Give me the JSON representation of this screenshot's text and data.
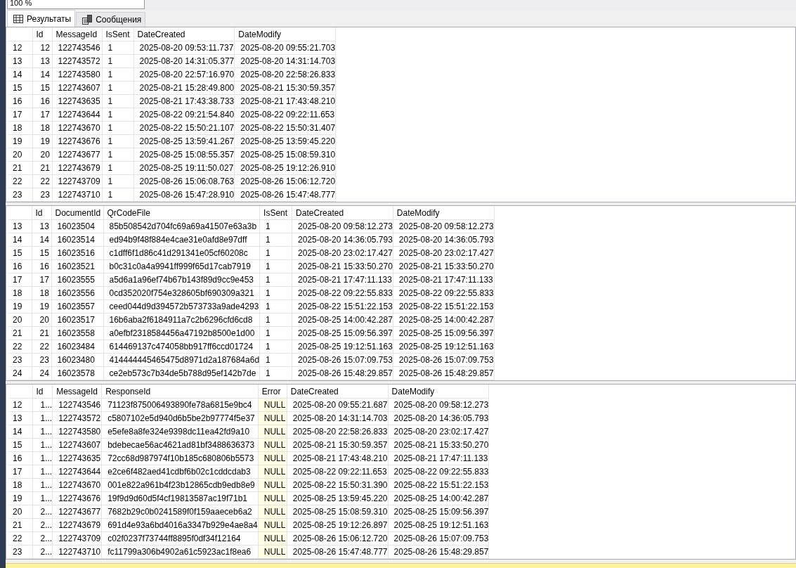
{
  "zoom": {
    "value": "100 %"
  },
  "tabs": [
    {
      "label": "Результаты",
      "kind": "grid",
      "selected": true
    },
    {
      "label": "Сообщения",
      "kind": "messages",
      "selected": false
    }
  ],
  "grids": [
    {
      "columns": [
        {
          "name": "Id",
          "kind": "text"
        },
        {
          "name": "MessageId",
          "kind": "text"
        },
        {
          "name": "IsSent",
          "kind": "text"
        },
        {
          "name": "DateCreated",
          "kind": "text"
        },
        {
          "name": "DateModify",
          "kind": "text"
        }
      ],
      "rows": [
        {
          "number": "12",
          "cells": [
            "12",
            "122743546",
            "1",
            "2025-08-20 09:53:11.737",
            "2025-08-20 09:55:21.703"
          ]
        },
        {
          "number": "13",
          "cells": [
            "13",
            "122743572",
            "1",
            "2025-08-20 14:31:05.377",
            "2025-08-20 14:31:14.703"
          ]
        },
        {
          "number": "14",
          "cells": [
            "14",
            "122743580",
            "1",
            "2025-08-20 22:57:16.970",
            "2025-08-20 22:58:26.833"
          ]
        },
        {
          "number": "15",
          "cells": [
            "15",
            "122743607",
            "1",
            "2025-08-21 15:28:49.800",
            "2025-08-21 15:30:59.357"
          ]
        },
        {
          "number": "16",
          "cells": [
            "16",
            "122743635",
            "1",
            "2025-08-21 17:43:38.733",
            "2025-08-21 17:43:48.210"
          ]
        },
        {
          "number": "17",
          "cells": [
            "17",
            "122743644",
            "1",
            "2025-08-22 09:21:54.840",
            "2025-08-22 09:22:11.653"
          ]
        },
        {
          "number": "18",
          "cells": [
            "18",
            "122743670",
            "1",
            "2025-08-22 15:50:21.107",
            "2025-08-22 15:50:31.407"
          ]
        },
        {
          "number": "19",
          "cells": [
            "19",
            "122743676",
            "1",
            "2025-08-25 13:59:41.267",
            "2025-08-25 13:59:45.220"
          ]
        },
        {
          "number": "20",
          "cells": [
            "20",
            "122743677",
            "1",
            "2025-08-25 15:08:55.357",
            "2025-08-25 15:08:59.310"
          ]
        },
        {
          "number": "21",
          "cells": [
            "21",
            "122743679",
            "1",
            "2025-08-25 19:11:50.027",
            "2025-08-25 19:12:26.910"
          ]
        },
        {
          "number": "22",
          "cells": [
            "22",
            "122743709",
            "1",
            "2025-08-26 15:06:08.763",
            "2025-08-26 15:06:12.720"
          ]
        },
        {
          "number": "23",
          "cells": [
            "23",
            "122743710",
            "1",
            "2025-08-26 15:47:28.910",
            "2025-08-26 15:47:48.777"
          ]
        }
      ]
    },
    {
      "columns": [
        {
          "name": "Id",
          "kind": "text"
        },
        {
          "name": "DocumentId",
          "kind": "text"
        },
        {
          "name": "QrCodeFile",
          "kind": "text"
        },
        {
          "name": "IsSent",
          "kind": "text"
        },
        {
          "name": "DateCreated",
          "kind": "text"
        },
        {
          "name": "DateModify",
          "kind": "text"
        }
      ],
      "rows": [
        {
          "number": "13",
          "cells": [
            "13",
            "16023504",
            "85b508542d704fc69a69a41507e63a3b",
            "1",
            "2025-08-20 09:58:12.273",
            "2025-08-20 09:58:12.273"
          ]
        },
        {
          "number": "14",
          "cells": [
            "14",
            "16023514",
            "ed94b9f48f884e4cae31e0afd8e97dff",
            "1",
            "2025-08-20 14:36:05.793",
            "2025-08-20 14:36:05.793"
          ]
        },
        {
          "number": "15",
          "cells": [
            "15",
            "16023516",
            "c1dff6f1d86c41d291341e05cf60208c",
            "1",
            "2025-08-20 23:02:17.427",
            "2025-08-20 23:02:17.427"
          ]
        },
        {
          "number": "16",
          "cells": [
            "16",
            "16023521",
            "b0c31c0a4a9941ff999f65d17cab7919",
            "1",
            "2025-08-21 15:33:50.270",
            "2025-08-21 15:33:50.270"
          ]
        },
        {
          "number": "17",
          "cells": [
            "17",
            "16023555",
            "a5d6a1a96ef74b67b143f89d9cc9e453",
            "1",
            "2025-08-21 17:47:11.133",
            "2025-08-21 17:47:11.133"
          ]
        },
        {
          "number": "18",
          "cells": [
            "18",
            "16023556",
            "0cd352020f754e328605bf690309a321",
            "1",
            "2025-08-22 09:22:55.833",
            "2025-08-22 09:22:55.833"
          ]
        },
        {
          "number": "19",
          "cells": [
            "19",
            "16023557",
            "ceed044d9d394572b573733a9ade4293",
            "1",
            "2025-08-22 15:51:22.153",
            "2025-08-22 15:51:22.153"
          ]
        },
        {
          "number": "20",
          "cells": [
            "20",
            "16023517",
            "16b6aba2f6184911a7c2b6296cfd6cd8",
            "1",
            "2025-08-25 14:00:42.287",
            "2025-08-25 14:00:42.287"
          ]
        },
        {
          "number": "21",
          "cells": [
            "21",
            "16023558",
            "a0efbf2318584456a47192b8500e1d00",
            "1",
            "2025-08-25 15:09:56.397",
            "2025-08-25 15:09:56.397"
          ]
        },
        {
          "number": "22",
          "cells": [
            "22",
            "16023484",
            "614469137c474058bb917ff6ccd01724",
            "1",
            "2025-08-25 19:12:51.163",
            "2025-08-25 19:12:51.163"
          ]
        },
        {
          "number": "23",
          "cells": [
            "23",
            "16023480",
            "414444445465475d8971d2a187684a6d",
            "1",
            "2025-08-26 15:07:09.753",
            "2025-08-26 15:07:09.753"
          ]
        },
        {
          "number": "24",
          "cells": [
            "24",
            "16023578",
            "ce2eb573c7b34de5b788d95ef142b7de",
            "1",
            "2025-08-26 15:48:29.857",
            "2025-08-26 15:48:29.857"
          ]
        }
      ]
    },
    {
      "columns": [
        {
          "name": "Id",
          "kind": "text"
        },
        {
          "name": "MessageId",
          "kind": "text"
        },
        {
          "name": "ResponseId",
          "kind": "text"
        },
        {
          "name": "Error",
          "kind": "null"
        },
        {
          "name": "DateCreated",
          "kind": "text"
        },
        {
          "name": "DateModify",
          "kind": "text"
        }
      ],
      "rows": [
        {
          "number": "12",
          "cells": [
            "1...",
            "122743546",
            "71123f875006493890fe78a6815e9bc4",
            "NULL",
            "2025-08-20 09:55:21.687",
            "2025-08-20 09:58:12.273"
          ]
        },
        {
          "number": "13",
          "cells": [
            "1...",
            "122743572",
            "c5807102e5d940d6b5be2b97774f5e37",
            "NULL",
            "2025-08-20 14:31:14.703",
            "2025-08-20 14:36:05.793"
          ]
        },
        {
          "number": "14",
          "cells": [
            "1...",
            "122743580",
            "e5efe8a8fe324e9398dc11ea42fd9a10",
            "NULL",
            "2025-08-20 22:58:26.833",
            "2025-08-20 23:02:17.427"
          ]
        },
        {
          "number": "15",
          "cells": [
            "1...",
            "122743607",
            "bdebecae56ac4621ad81bf3488636373",
            "NULL",
            "2025-08-21 15:30:59.357",
            "2025-08-21 15:33:50.270"
          ]
        },
        {
          "number": "16",
          "cells": [
            "1...",
            "122743635",
            "72cc68d987974f10b185c680806b5573",
            "NULL",
            "2025-08-21 17:43:48.210",
            "2025-08-21 17:47:11.133"
          ]
        },
        {
          "number": "17",
          "cells": [
            "1...",
            "122743644",
            "e2ce6f482aed41cdbf6b02c1cddcdab3",
            "NULL",
            "2025-08-22 09:22:11.653",
            "2025-08-22 09:22:55.833"
          ]
        },
        {
          "number": "18",
          "cells": [
            "1...",
            "122743670",
            "001e822a961b4f23b12865cdb9edb8e9",
            "NULL",
            "2025-08-22 15:50:31.390",
            "2025-08-22 15:51:22.153"
          ]
        },
        {
          "number": "19",
          "cells": [
            "1...",
            "122743676",
            "19f9d9d60d5f4cf19813587ac19f71b1",
            "NULL",
            "2025-08-25 13:59:45.220",
            "2025-08-25 14:00:42.287"
          ]
        },
        {
          "number": "20",
          "cells": [
            "2...",
            "122743677",
            "7682b29c0b0241589f0f159aaeceb6a2",
            "NULL",
            "2025-08-25 15:08:59.310",
            "2025-08-25 15:09:56.397"
          ]
        },
        {
          "number": "21",
          "cells": [
            "2...",
            "122743679",
            "691d4e93a6bd4016a3347b929e4ae8a4",
            "NULL",
            "2025-08-25 19:12:26.897",
            "2025-08-25 19:12:51.163"
          ]
        },
        {
          "number": "22",
          "cells": [
            "2...",
            "122743709",
            "c02f0237f73744ff8895f0df34f12164",
            "NULL",
            "2025-08-26 15:06:12.720",
            "2025-08-26 15:07:09.753"
          ]
        },
        {
          "number": "23",
          "cells": [
            "2...",
            "122743710",
            "fc11799a306b4902a61c5923ac1f8ea6",
            "NULL",
            "2025-08-26 15:47:48.777",
            "2025-08-26 15:48:29.857"
          ]
        }
      ]
    }
  ]
}
